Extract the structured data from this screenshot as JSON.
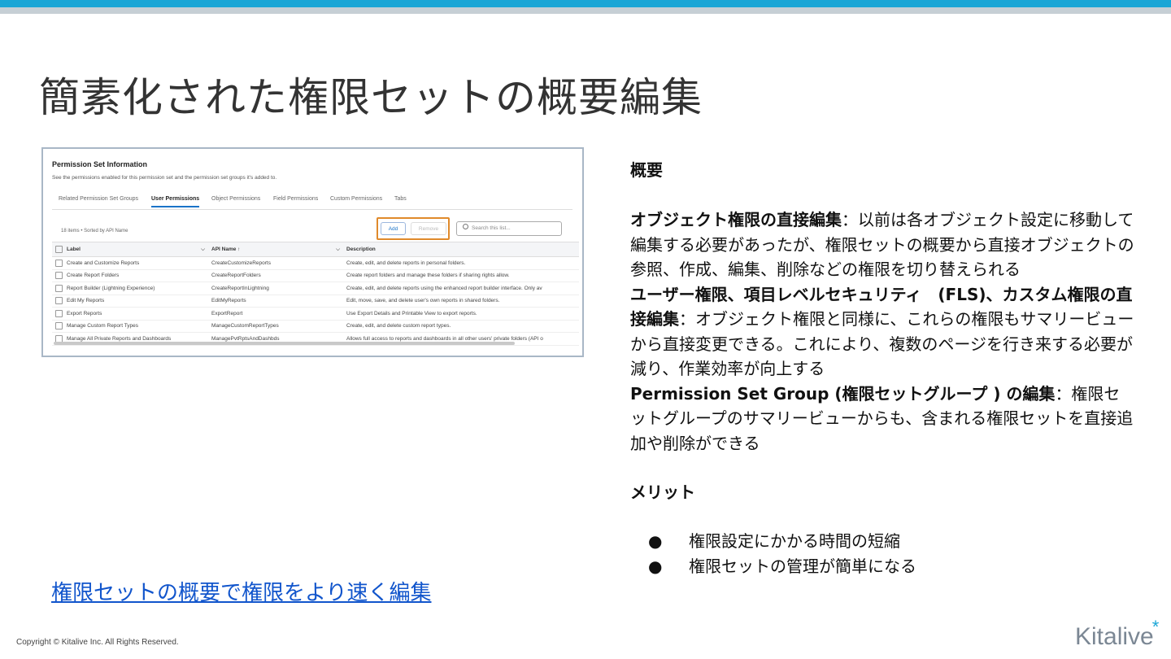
{
  "title": "簡素化された権限セットの概要編集",
  "screenshot": {
    "heading": "Permission Set Information",
    "subheading": "See the permissions enabled for this permission set and the permission set groups it's added to.",
    "tabs": [
      "Related Permission Set Groups",
      "User Permissions",
      "Object Permissions",
      "Field Permissions",
      "Custom Permissions",
      "Tabs"
    ],
    "active_tab": "User Permissions",
    "meta": "18 items • Sorted by API Name",
    "add_label": "Add",
    "remove_label": "Remove",
    "search_placeholder": "Search this list...",
    "columns": [
      "Label",
      "API Name ↑",
      "Description"
    ],
    "rows": [
      {
        "label": "Create and Customize Reports",
        "api": "CreateCustomizeReports",
        "desc": "Create, edit, and delete reports in personal folders."
      },
      {
        "label": "Create Report Folders",
        "api": "CreateReportFolders",
        "desc": "Create report folders and manage these folders if sharing rights allow."
      },
      {
        "label": "Report Builder (Lightning Experience)",
        "api": "CreateReportInLightning",
        "desc": "Create, edit, and delete reports using the enhanced report builder interface. Only av"
      },
      {
        "label": "Edit My Reports",
        "api": "EditMyReports",
        "desc": "Edit, move, save, and delete user's own reports in shared folders."
      },
      {
        "label": "Export Reports",
        "api": "ExportReport",
        "desc": "Use Export Details and Printable View to export reports."
      },
      {
        "label": "Manage Custom Report Types",
        "api": "ManageCustomReportTypes",
        "desc": "Create, edit, and delete custom report types."
      },
      {
        "label": "Manage All Private Reports and Dashboards",
        "api": "ManagePvtRptsAndDashbds",
        "desc": "Allows full access to reports and dashboards in all other users' private folders (API o"
      }
    ]
  },
  "summary": {
    "overview_heading": "概要",
    "p1_bold": "オブジェクト権限の直接編集",
    "p1_text": "：以前は各オブジェクト設定に移動して編集する必要があったが、権限セットの概要から直接オブジェクトの参照、作成、編集、削除などの権限を切り替えられる",
    "p2_bold": "ユーザー権限、項目レベルセキュリティ　(FLS)、カスタム権限の直接編集",
    "p2_text": "：オブジェクト権限と同様に、これらの権限もサマリービューから直接変更できる。これにより、複数のページを行き来する必要が減り、作業効率が向上する",
    "p3_bold": "Permission Set Group (権限セットグループ ) の編集",
    "p3_text": "：権限セットグループのサマリービューからも、含まれる権限セットを直接追加や削除ができる",
    "merit_heading": "メリット",
    "merits": [
      "権限設定にかかる時間の短縮",
      "権限セットの管理が簡単になる"
    ]
  },
  "link_text": "権限セットの概要で権限をより速く編集",
  "copyright": "Copyright © Kitalive Inc. All Rights Reserved.",
  "logo_text": "Kitalive",
  "colors": {
    "accent_bar": "#1aa6d6",
    "highlight_box": "#e08a2b",
    "link": "#1155cc"
  }
}
